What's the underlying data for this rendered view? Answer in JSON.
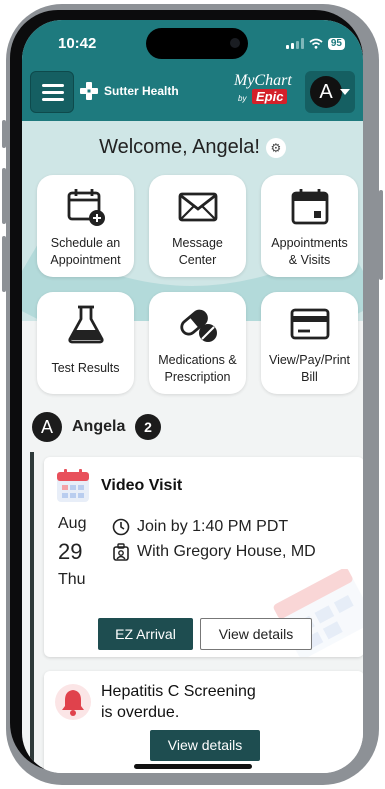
{
  "status": {
    "time": "10:42",
    "battery": "95"
  },
  "header": {
    "brand": "Sutter Health",
    "mychart": "MyChart",
    "by": "by",
    "epic": "Epic",
    "account_initial": "A"
  },
  "welcome": {
    "text": "Welcome, Angela!"
  },
  "tiles": [
    {
      "line1": "Schedule an",
      "line2": "Appointment",
      "icon": "calendar-plus-icon"
    },
    {
      "line1": "Message",
      "line2": "Center",
      "icon": "envelope-icon"
    },
    {
      "line1": "Appointments",
      "line2": "& Visits",
      "icon": "calendar-icon"
    },
    {
      "line1": "Test Results",
      "line2": "",
      "icon": "flask-icon"
    },
    {
      "line1": "Medications &",
      "line2": "Prescription",
      "icon": "pill-icon"
    },
    {
      "line1": "View/Pay/Print",
      "line2": "Bill",
      "icon": "credit-card-icon"
    }
  ],
  "section": {
    "initial": "A",
    "name": "Angela",
    "count": "2"
  },
  "video_visit": {
    "title": "Video Visit",
    "month": "Aug",
    "day": "29",
    "weekday": "Thu",
    "join": "Join by 1:40 PM PDT",
    "provider": "With Gregory House, MD",
    "ez_label": "EZ Arrival",
    "details_label": "View details"
  },
  "reminder": {
    "line1": "Hepatitis C Screening",
    "line2": "is overdue.",
    "details_label": "View details"
  },
  "colors": {
    "teal": "#1e7a7e",
    "dark_teal": "#1e4d50",
    "epic_red": "#d4202a"
  }
}
